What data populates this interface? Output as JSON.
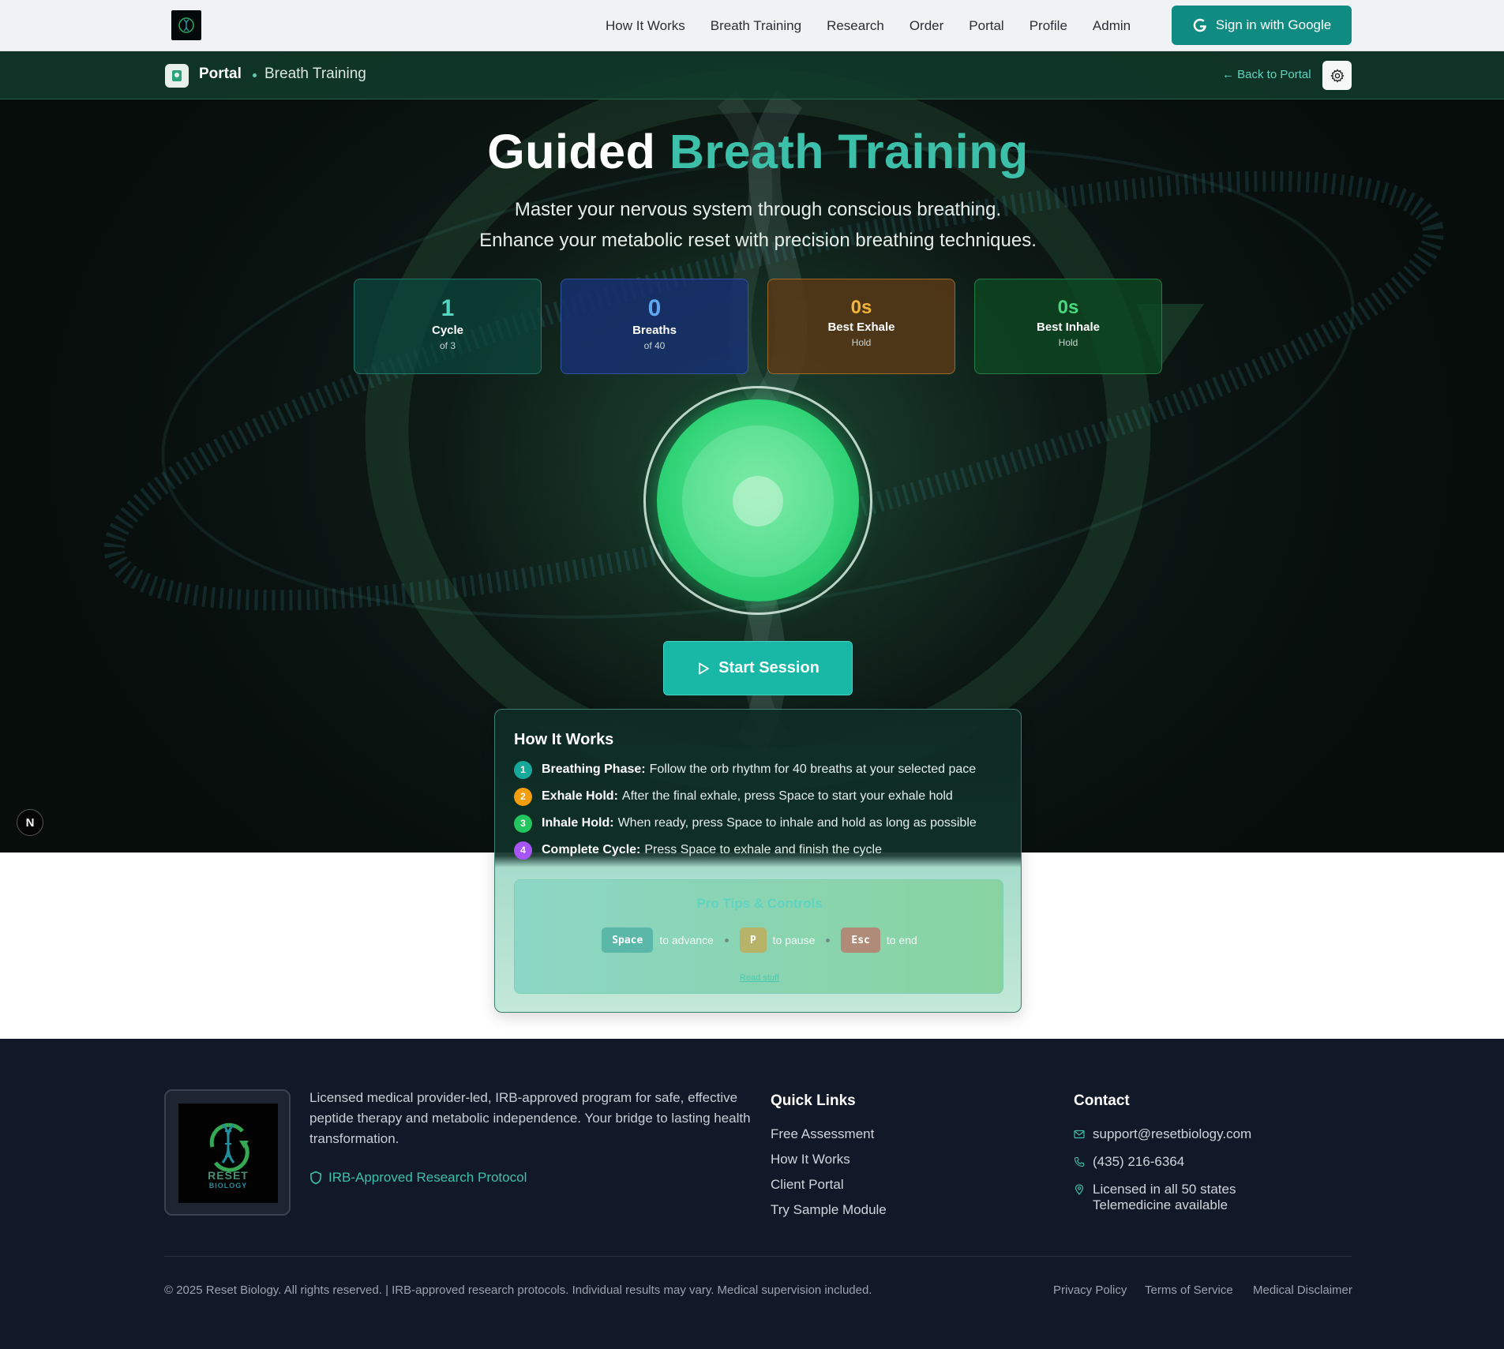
{
  "nav": {
    "links": [
      "How It Works",
      "Breath Training",
      "Research",
      "Order",
      "Portal",
      "Profile",
      "Admin"
    ],
    "signin_label": "Sign in with Google"
  },
  "breadcrumb": {
    "portal": "Portal",
    "current": "Breath Training",
    "back": "← Back to Portal"
  },
  "hero": {
    "title_main": "Guided",
    "title_accent": "Breath Training",
    "subtitle_line1": "Master your nervous system through conscious breathing.",
    "subtitle_line2": "Enhance your metabolic reset with precision breathing techniques."
  },
  "stats": {
    "cycle": {
      "value": "1",
      "label": "Cycle",
      "sub": "of 3"
    },
    "breaths": {
      "value": "0",
      "label": "Breaths",
      "sub": "of 40"
    },
    "exhale": {
      "value": "0s",
      "label": "Best Exhale",
      "sub": "Hold"
    },
    "inhale": {
      "value": "0s",
      "label": "Best Inhale",
      "sub": "Hold"
    }
  },
  "start_label": "Start Session",
  "how_it_works": {
    "title": "How It Works",
    "steps": [
      {
        "num": "1",
        "bold": "Breathing Phase:",
        "text": "Follow the orb rhythm for 40 breaths at your selected pace",
        "color": "#16a89a"
      },
      {
        "num": "2",
        "bold": "Exhale Hold:",
        "text": "After the final exhale, press Space to start your exhale hold",
        "color": "#f59e0b"
      },
      {
        "num": "3",
        "bold": "Inhale Hold:",
        "text": "When ready, press Space to inhale and hold as long as possible",
        "color": "#22c55e"
      },
      {
        "num": "4",
        "bold": "Complete Cycle:",
        "text": "Press Space to exhale and finish the cycle",
        "color": "#a855f7"
      }
    ],
    "tips": {
      "title": "Pro Tips & Controls",
      "keys": [
        {
          "key": "Space",
          "text": "to advance",
          "color": "#5bb8a8"
        },
        {
          "key": "P",
          "text": "to pause",
          "color": "#b7b46a"
        },
        {
          "key": "Esc",
          "text": "to end",
          "color": "#b08c78"
        }
      ],
      "link": "Read stuff"
    }
  },
  "footer": {
    "logo_text1": "RESET",
    "logo_text2": "BIOLOGY",
    "description": "Licensed medical provider-led, IRB-approved program for safe, effective peptide therapy and metabolic independence. Your bridge to lasting health transformation.",
    "irb": "IRB-Approved Research Protocol",
    "quick_links_title": "Quick Links",
    "quick_links": [
      "Free Assessment",
      "How It Works",
      "Client Portal",
      "Try Sample Module"
    ],
    "contact_title": "Contact",
    "email": "support@resetbiology.com",
    "phone": "(435) 216-6364",
    "licensed_line1": "Licensed in all 50 states",
    "licensed_line2": "Telemedicine available",
    "copyright": "© 2025 Reset Biology. All rights reserved. | IRB-approved research protocols. Individual results may vary. Medical supervision included.",
    "legal": [
      "Privacy Policy",
      "Terms of Service",
      "Medical Disclaimer"
    ]
  },
  "colors": {
    "brand_teal": "#0f8b82",
    "accent": "#3cc0a9",
    "orb_green": "#35d57a",
    "footer_bg": "#111827"
  }
}
